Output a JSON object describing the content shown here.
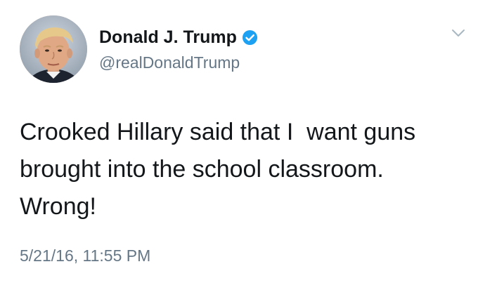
{
  "tweet": {
    "display_name": "Donald J. Trump",
    "handle": "@realDonaldTrump",
    "verified": true,
    "text_lines": [
      "Crooked Hillary said that I  want guns",
      "brought into the school classroom.",
      "Wrong!"
    ],
    "timestamp": "5/21/16, 11:55 PM"
  },
  "icons": {
    "avatar": "profile-photo",
    "verified": "verified-badge-icon",
    "menu": "chevron-down-icon"
  },
  "colors": {
    "text_primary": "#14171a",
    "text_secondary": "#657786",
    "verified_blue": "#1da1f2",
    "chevron": "#aab8c2",
    "background": "#ffffff"
  }
}
